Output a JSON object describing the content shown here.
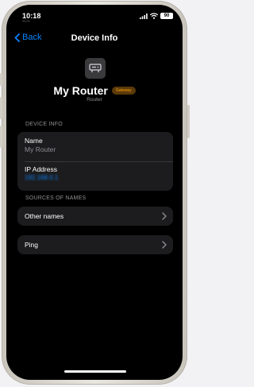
{
  "status_bar": {
    "time": "10:18",
    "sub_text": "--:--",
    "battery": "90",
    "icons": [
      "signal-icon",
      "wifi-icon",
      "battery-icon"
    ]
  },
  "nav": {
    "back_label": "Back",
    "title": "Device Info"
  },
  "device": {
    "icon": "router-icon",
    "name": "My Router",
    "badge": "Gateway",
    "type": "Router"
  },
  "device_info": {
    "header": "DEVICE INFO",
    "name_label": "Name",
    "name_value": "My Router",
    "ip_label": "IP Address",
    "ip_value": "192.168.0.1"
  },
  "sources": {
    "header": "SOURCES OF NAMES",
    "other_names_label": "Other names"
  },
  "ping": {
    "label": "Ping"
  },
  "colors": {
    "accent": "#0a84ff",
    "badge_text": "#ff9f0a",
    "background": "#000000",
    "card": "#1c1c1e"
  }
}
